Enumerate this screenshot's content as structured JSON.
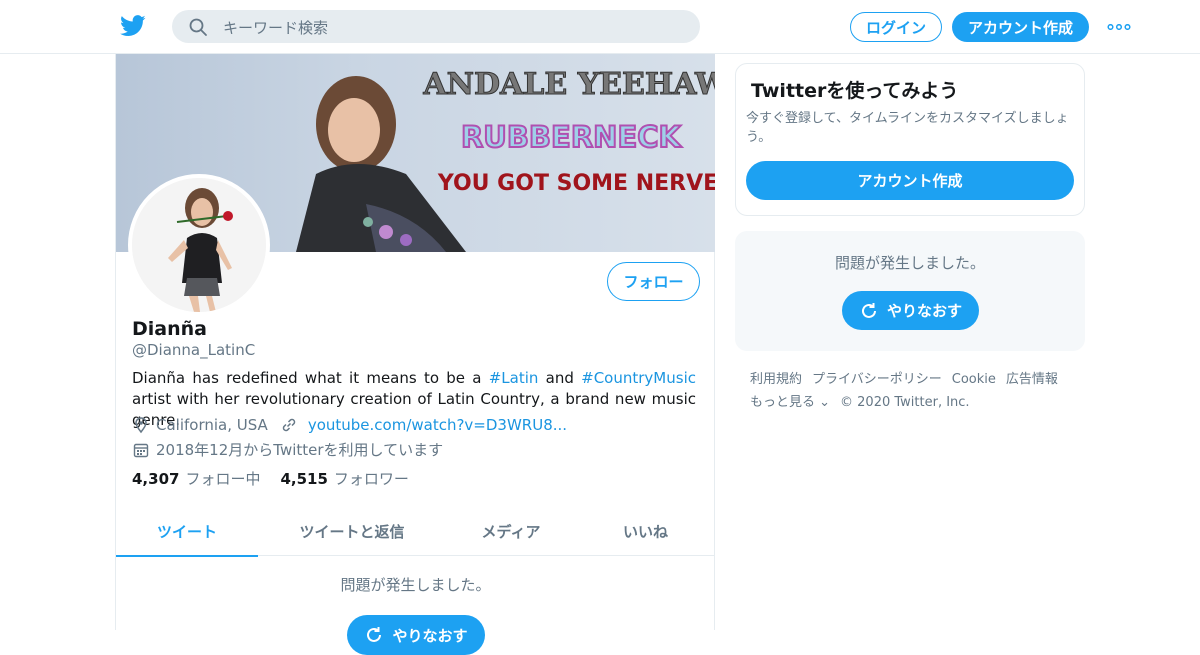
{
  "header": {
    "search_placeholder": "キーワード検索",
    "login_label": "ログイン",
    "signup_label": "アカウント作成"
  },
  "banner": {
    "line1": "ANDALE YEEHAW",
    "line2": "RUBBERNECK",
    "line3": "YOU GOT SOME NERVE"
  },
  "profile": {
    "follow_label": "フォロー",
    "name": "Dianña",
    "handle": "@Dianna_LatinC",
    "bio_parts": {
      "p1": "Dianña has redefined what it means to be a ",
      "tag1": "#Latin",
      "p2": " and ",
      "tag2": "#CountryMusic",
      "p3": " artist with her revolutionary creation of Latin Country, a brand new music genre."
    },
    "location": "California, USA",
    "url": "youtube.com/watch?v=D3WRU8...",
    "joined": "2018年12月からTwitterを利用しています",
    "following_count": "4,307",
    "following_label": "フォロー中",
    "followers_count": "4,515",
    "followers_label": "フォロワー"
  },
  "tabs": [
    {
      "label": "ツイート",
      "active": true
    },
    {
      "label": "ツイートと返信",
      "active": false
    },
    {
      "label": "メディア",
      "active": false
    },
    {
      "label": "いいね",
      "active": false
    }
  ],
  "timeline": {
    "error": "問題が発生しました。",
    "retry_label": "やりなおす"
  },
  "sidebar": {
    "signup_title": "Twitterを使ってみよう",
    "signup_desc": "今すぐ登録して、タイムラインをカスタマイズしましょう。",
    "signup_button": "アカウント作成",
    "error": "問題が発生しました。",
    "retry_label": "やりなおす"
  },
  "footer": {
    "links": [
      "利用規約",
      "プライバシーポリシー",
      "Cookie",
      "広告情報",
      "もっと見る ⌄"
    ],
    "copyright": "© 2020 Twitter, Inc."
  },
  "colors": {
    "accent": "#1da1f2",
    "link": "#1b95e0",
    "muted": "#657786"
  }
}
